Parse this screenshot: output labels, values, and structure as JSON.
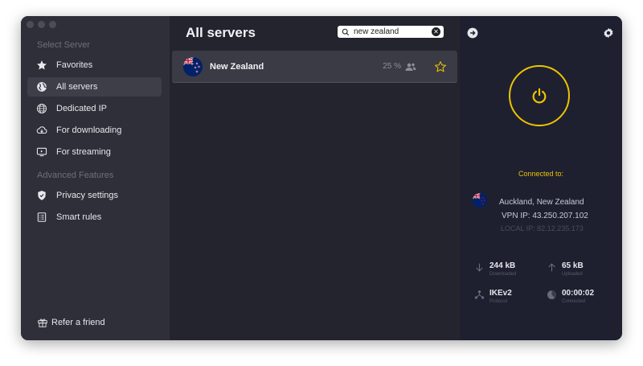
{
  "sidebar": {
    "select_server_label": "Select Server",
    "items": [
      {
        "label": "Favorites",
        "icon": "star-icon"
      },
      {
        "label": "All servers",
        "icon": "globe-icon"
      },
      {
        "label": "Dedicated IP",
        "icon": "dedicated-ip-icon"
      },
      {
        "label": "For downloading",
        "icon": "cloud-download-icon"
      },
      {
        "label": "For streaming",
        "icon": "streaming-icon"
      }
    ],
    "advanced_label": "Advanced Features",
    "advanced_items": [
      {
        "label": "Privacy settings",
        "icon": "shield-icon"
      },
      {
        "label": "Smart rules",
        "icon": "rules-icon"
      }
    ],
    "refer_label": "Refer a friend",
    "active_item": "All servers"
  },
  "main": {
    "title": "All servers",
    "search": {
      "value": "new zealand",
      "placeholder": ""
    },
    "servers": [
      {
        "name": "New Zealand",
        "load": "25 %",
        "favorite": false
      }
    ]
  },
  "status": {
    "connected_label": "Connected to:",
    "location": "Auckland, New Zealand",
    "vpn_ip": "VPN IP: 43.250.207.102",
    "local_ip": "LOCAL IP: 82.12.235.173",
    "downloaded": {
      "value": "244 kB",
      "label": "Downloaded"
    },
    "uploaded": {
      "value": "65 kB",
      "label": "Uploaded"
    },
    "protocol": {
      "value": "IKEv2",
      "label": "Protocol"
    },
    "connected_time": {
      "value": "00:00:02",
      "label": "Connected"
    }
  },
  "colors": {
    "accent": "#ecc400",
    "sidebar_bg": "#2e2f38",
    "main_bg": "#23242d",
    "status_bg": "#1e2030"
  }
}
